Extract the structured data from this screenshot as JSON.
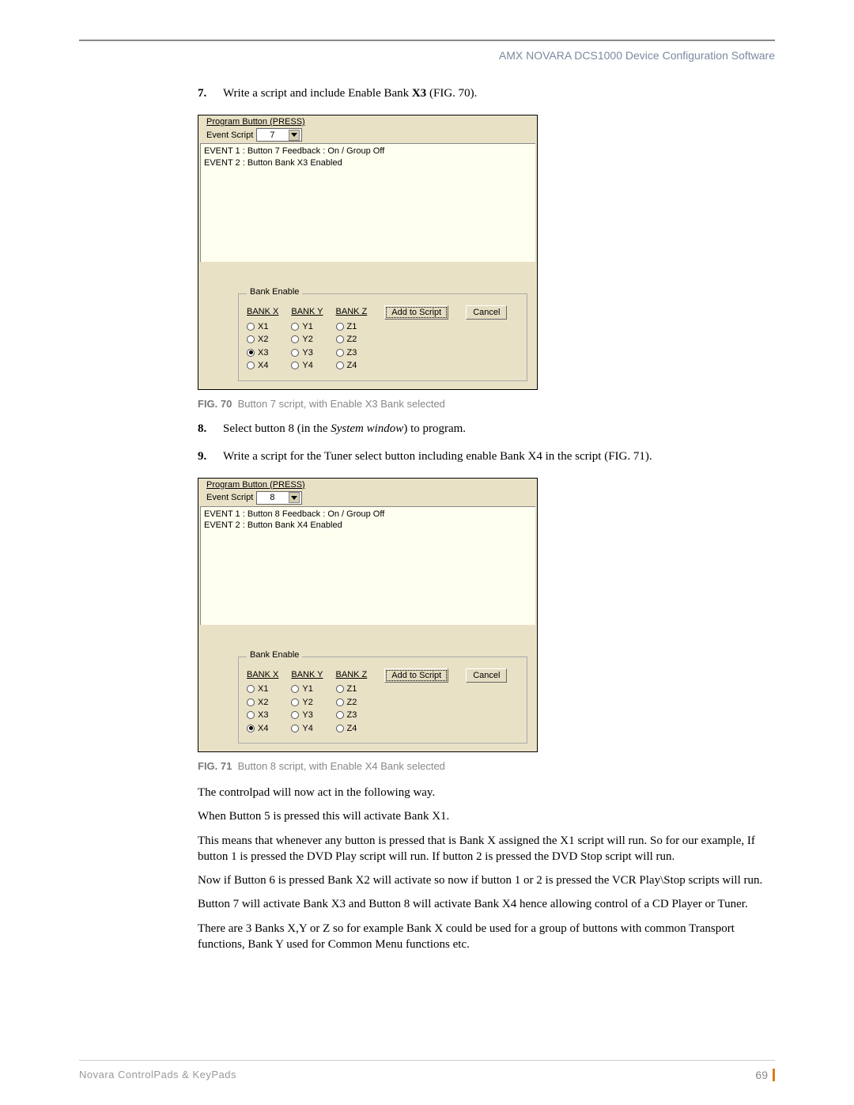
{
  "header": {
    "title": "AMX NOVARA DCS1000 Device Configuration Software"
  },
  "steps": {
    "s7": {
      "num": "7.",
      "pre": "Write a script and include Enable Bank ",
      "bold": "X3",
      "post": " (FIG. 70)."
    },
    "s8": {
      "num": "8.",
      "pre": "Select button 8 (in the ",
      "ital": "System window",
      "post": ") to program."
    },
    "s9": {
      "num": "9.",
      "body": "Write a script for the Tuner select button including enable Bank X4 in the script (FIG. 71)."
    }
  },
  "fig70": {
    "progTitle": "Program Button (PRESS)",
    "escLabel": "Event Script",
    "escValue": "7",
    "line1": "EVENT 1 : Button 7 Feedback : On / Group Off",
    "line2": "EVENT 2 : Button Bank X3 Enabled",
    "bankLegend": "Bank Enable",
    "bankX": {
      "hdr": "BANK X",
      "o1": "X1",
      "o2": "X2",
      "o3": "X3",
      "o4": "X4"
    },
    "bankY": {
      "hdr": "BANK Y",
      "o1": "Y1",
      "o2": "Y2",
      "o3": "Y3",
      "o4": "Y4"
    },
    "bankZ": {
      "hdr": "BANK Z",
      "o1": "Z1",
      "o2": "Z2",
      "o3": "Z3",
      "o4": "Z4"
    },
    "btnAdd": "Add to Script",
    "btnCancel": "Cancel",
    "captionLbl": "FIG. 70",
    "captionBody": "Button 7 script, with Enable X3 Bank selected"
  },
  "fig71": {
    "progTitle": "Program Button (PRESS)",
    "escLabel": "Event Script",
    "escValue": "8",
    "line1": "EVENT 1 : Button 8 Feedback : On / Group Off",
    "line2": "EVENT 2 : Button Bank X4 Enabled",
    "bankLegend": "Bank Enable",
    "bankX": {
      "hdr": "BANK X",
      "o1": "X1",
      "o2": "X2",
      "o3": "X3",
      "o4": "X4"
    },
    "bankY": {
      "hdr": "BANK Y",
      "o1": "Y1",
      "o2": "Y2",
      "o3": "Y3",
      "o4": "Y4"
    },
    "bankZ": {
      "hdr": "BANK Z",
      "o1": "Z1",
      "o2": "Z2",
      "o3": "Z3",
      "o4": "Z4"
    },
    "btnAdd": "Add to Script",
    "btnCancel": "Cancel",
    "captionLbl": "FIG. 71",
    "captionBody": "Button 8 script, with Enable X4 Bank selected"
  },
  "paras": {
    "p1": "The controlpad will now act in the following way.",
    "p2": "When Button 5 is pressed this will activate Bank X1.",
    "p3": "This means that whenever any button is pressed that is Bank X assigned the X1 script will run. So for our example, If button 1 is pressed the DVD Play script will run. If button 2 is pressed the DVD Stop script will run.",
    "p4": "Now if Button 6 is pressed Bank X2 will activate so now if button 1 or 2 is pressed the VCR Play\\Stop scripts will run.",
    "p5": "Button 7 will activate Bank X3 and Button 8 will activate Bank X4 hence allowing control of a CD Player or Tuner.",
    "p6": "There are 3 Banks X,Y or Z so for example Bank X could be used for a group of buttons with common Transport functions, Bank Y used for Common Menu functions etc."
  },
  "footer": {
    "left": "Novara ControlPads   & KeyPads",
    "right": "69"
  }
}
